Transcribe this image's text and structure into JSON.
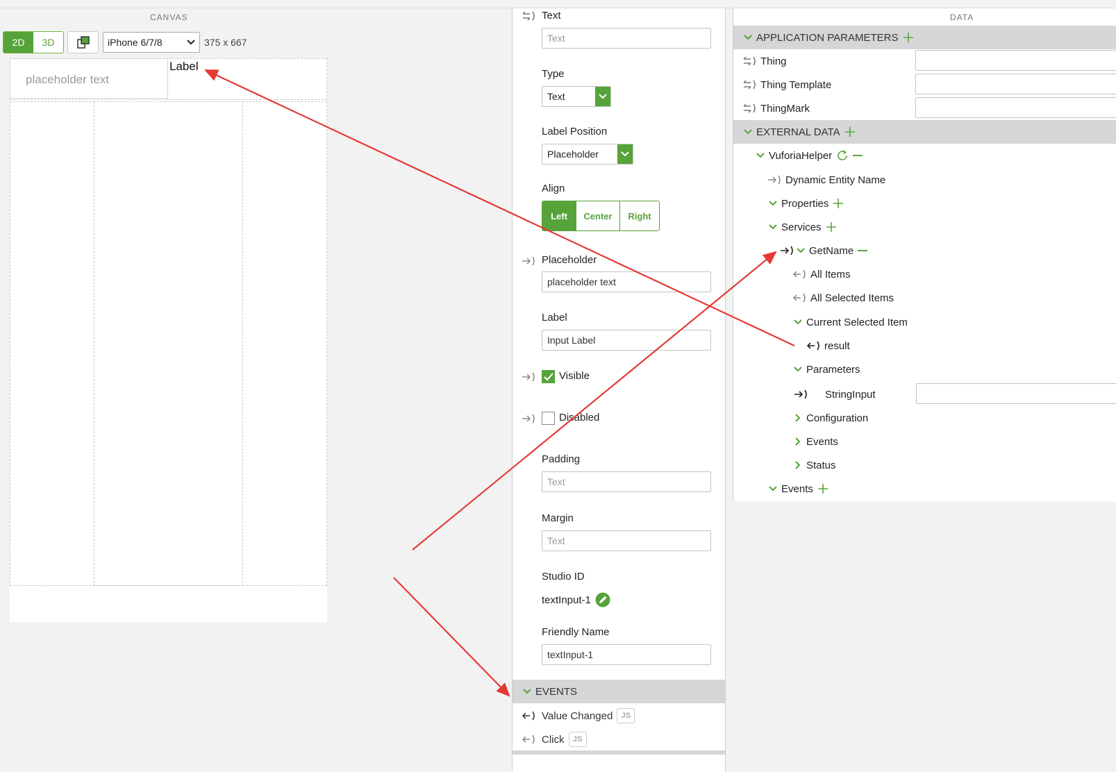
{
  "canvas": {
    "title": "CANVAS",
    "mode_2d": "2D",
    "mode_3d": "3D",
    "device": "iPhone 6/7/8",
    "dimensions": "375 x 667",
    "input_placeholder": "placeholder text",
    "label": "Label"
  },
  "properties": {
    "text_label": "Text",
    "text_placeholder": "Text",
    "type_label": "Type",
    "type_value": "Text",
    "label_position_label": "Label Position",
    "label_position_value": "Placeholder",
    "align_label": "Align",
    "align_left": "Left",
    "align_center": "Center",
    "align_right": "Right",
    "placeholder_label": "Placeholder",
    "placeholder_value": "placeholder text",
    "label_label": "Label",
    "label_value": "Input Label",
    "visible_label": "Visible",
    "disabled_label": "Disabled",
    "padding_label": "Padding",
    "padding_placeholder": "Text",
    "margin_label": "Margin",
    "margin_placeholder": "Text",
    "studio_id_label": "Studio ID",
    "studio_id_value": "textInput-1",
    "friendly_name_label": "Friendly Name",
    "friendly_name_value": "textInput-1",
    "events_header": "EVENTS",
    "event_value_changed": "Value Changed",
    "event_click": "Click",
    "js_badge": "JS"
  },
  "data_panel": {
    "title": "DATA",
    "app_params_header": "APPLICATION PARAMETERS",
    "thing": "Thing",
    "thing_template": "Thing Template",
    "thingmark": "ThingMark",
    "external_data_header": "EXTERNAL DATA",
    "vuforia_helper": "VuforiaHelper",
    "dynamic_entity_name": "Dynamic Entity Name",
    "properties": "Properties",
    "services": "Services",
    "getname": "GetName",
    "all_items": "All Items",
    "all_selected_items": "All Selected Items",
    "current_selected_item": "Current Selected Item",
    "result": "result",
    "parameters": "Parameters",
    "string_input": "StringInput",
    "configuration": "Configuration",
    "events_child": "Events",
    "status": "Status",
    "events": "Events"
  },
  "colors": {
    "accent": "#56a33a",
    "arrow": "#e53935",
    "section_bg": "#d6d6d9"
  }
}
